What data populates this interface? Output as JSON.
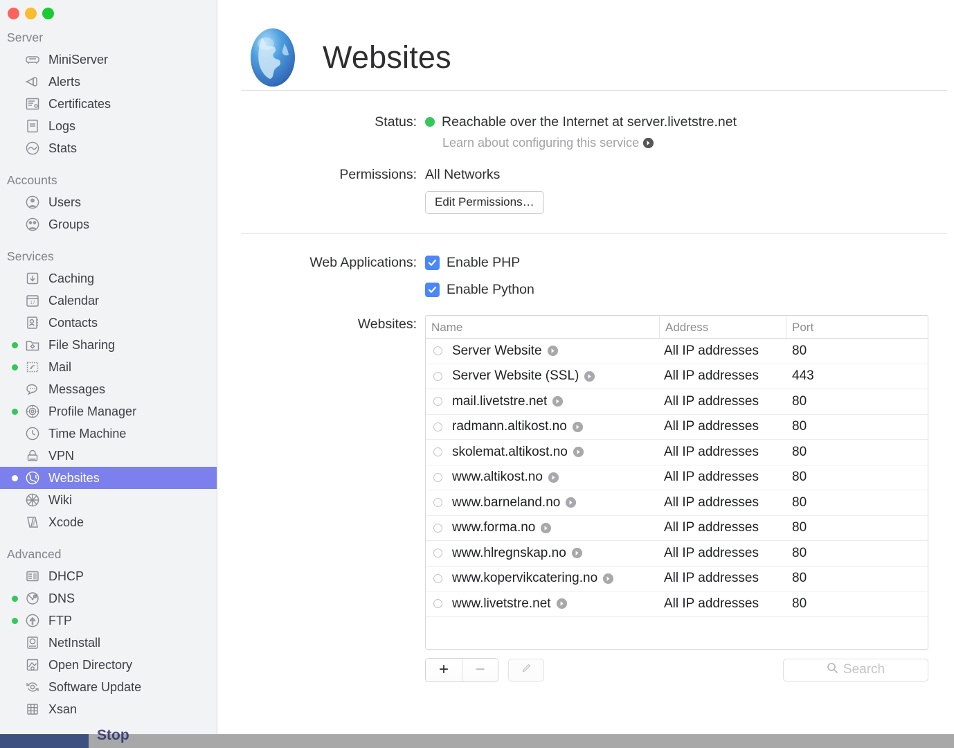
{
  "window": {
    "traffic_lights": [
      "close",
      "minimize",
      "zoom"
    ],
    "bottom_text": "Stop"
  },
  "sidebar": {
    "groups": [
      {
        "title": "Server",
        "items": [
          {
            "label": "MiniServer",
            "icon": "server-icon",
            "status": "none"
          },
          {
            "label": "Alerts",
            "icon": "megaphone-icon",
            "status": "none"
          },
          {
            "label": "Certificates",
            "icon": "certificate-icon",
            "status": "none"
          },
          {
            "label": "Logs",
            "icon": "document-icon",
            "status": "none"
          },
          {
            "label": "Stats",
            "icon": "graph-icon",
            "status": "none"
          }
        ]
      },
      {
        "title": "Accounts",
        "items": [
          {
            "label": "Users",
            "icon": "user-icon",
            "status": "none"
          },
          {
            "label": "Groups",
            "icon": "users-group-icon",
            "status": "none"
          }
        ]
      },
      {
        "title": "Services",
        "items": [
          {
            "label": "Caching",
            "icon": "download-box-icon",
            "status": "none"
          },
          {
            "label": "Calendar",
            "icon": "calendar-icon",
            "status": "none"
          },
          {
            "label": "Contacts",
            "icon": "contacts-icon",
            "status": "none"
          },
          {
            "label": "File Sharing",
            "icon": "folder-share-icon",
            "status": "on"
          },
          {
            "label": "Mail",
            "icon": "mail-stamp-icon",
            "status": "on"
          },
          {
            "label": "Messages",
            "icon": "chat-bubble-icon",
            "status": "none"
          },
          {
            "label": "Profile Manager",
            "icon": "gear-circle-icon",
            "status": "on"
          },
          {
            "label": "Time Machine",
            "icon": "clock-icon",
            "status": "none"
          },
          {
            "label": "VPN",
            "icon": "lock-icon",
            "status": "none"
          },
          {
            "label": "Websites",
            "icon": "globe-icon",
            "status": "on",
            "selected": true
          },
          {
            "label": "Wiki",
            "icon": "wiki-wheel-icon",
            "status": "none"
          },
          {
            "label": "Xcode",
            "icon": "hammer-icon",
            "status": "none"
          }
        ]
      },
      {
        "title": "Advanced",
        "items": [
          {
            "label": "DHCP",
            "icon": "id-card-icon",
            "status": "none"
          },
          {
            "label": "DNS",
            "icon": "tools-globe-icon",
            "status": "on"
          },
          {
            "label": "FTP",
            "icon": "upload-globe-icon",
            "status": "on"
          },
          {
            "label": "NetInstall",
            "icon": "netinstall-icon",
            "status": "none"
          },
          {
            "label": "Open Directory",
            "icon": "open-directory-icon",
            "status": "none"
          },
          {
            "label": "Software Update",
            "icon": "refresh-icon",
            "status": "none"
          },
          {
            "label": "Xsan",
            "icon": "xsan-cube-icon",
            "status": "none"
          }
        ]
      }
    ]
  },
  "header": {
    "title": "Websites",
    "icon": "globe-icon"
  },
  "status": {
    "label": "Status:",
    "indicator_color": "#35c759",
    "text": "Reachable over the Internet at server.livetstre.net",
    "learn_more": "Learn about configuring this service"
  },
  "permissions": {
    "label": "Permissions:",
    "value": "All Networks",
    "edit_button": "Edit Permissions…"
  },
  "web_applications": {
    "label": "Web Applications:",
    "options": [
      {
        "label": "Enable PHP",
        "checked": true
      },
      {
        "label": "Enable Python",
        "checked": true
      }
    ]
  },
  "websites": {
    "label": "Websites:",
    "columns": [
      "Name",
      "Address",
      "Port"
    ],
    "rows": [
      {
        "name": "Server Website",
        "address": "All IP addresses",
        "port": "80"
      },
      {
        "name": "Server Website (SSL)",
        "address": "All IP addresses",
        "port": "443"
      },
      {
        "name": "mail.livetstre.net",
        "address": "All IP addresses",
        "port": "80"
      },
      {
        "name": "radmann.altikost.no",
        "address": "All IP addresses",
        "port": "80"
      },
      {
        "name": "skolemat.altikost.no",
        "address": "All IP addresses",
        "port": "80"
      },
      {
        "name": "www.altikost.no",
        "address": "All IP addresses",
        "port": "80"
      },
      {
        "name": "www.barneland.no",
        "address": "All IP addresses",
        "port": "80"
      },
      {
        "name": "www.forma.no",
        "address": "All IP addresses",
        "port": "80"
      },
      {
        "name": "www.hlregnskap.no",
        "address": "All IP addresses",
        "port": "80"
      },
      {
        "name": "www.kopervikcatering.no",
        "address": "All IP addresses",
        "port": "80"
      },
      {
        "name": "www.livetstre.net",
        "address": "All IP addresses",
        "port": "80"
      }
    ]
  },
  "toolbar": {
    "add_label": "+",
    "remove_label": "−",
    "edit_icon": "pencil-icon",
    "search_placeholder": "Search",
    "search_value": "",
    "search_icon": "search-icon"
  },
  "colors": {
    "selection": "#7b80ec",
    "status_green": "#35c759",
    "checkbox_blue": "#4a87f7",
    "sidebar_bg": "#f2f3f5"
  }
}
